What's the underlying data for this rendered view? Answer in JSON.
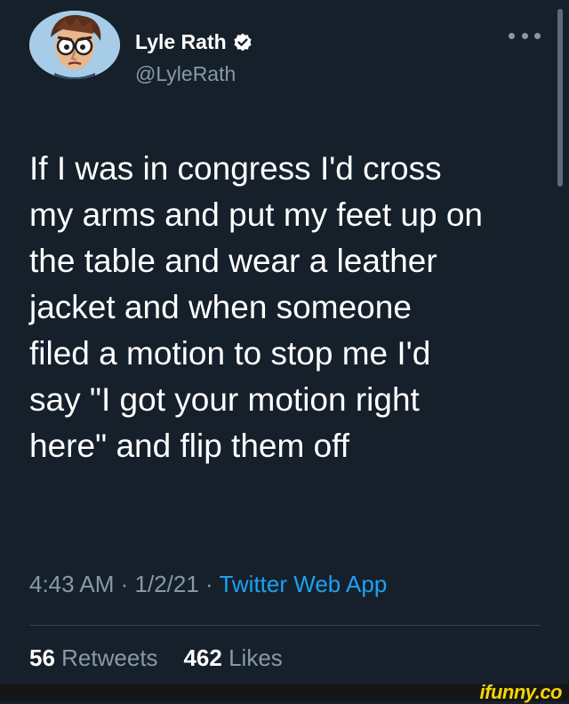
{
  "author": {
    "name": "Lyle Rath",
    "handle": "@LyleRath",
    "avatar_icon": "cartoon-face-avatar",
    "verified_icon": "verified-badge-icon"
  },
  "menu": {
    "icon": "more-options-icon"
  },
  "tweet": {
    "lines": [
      "If I was in congress I'd cross",
      "my arms and put my feet up on",
      "the table and wear a leather",
      "jacket and when someone",
      "filed a motion to stop me I'd",
      "say \"I got your motion right",
      "here\" and flip them off"
    ]
  },
  "meta": {
    "time": "4:43 AM",
    "separator": " · ",
    "date": "1/2/21",
    "source": "Twitter Web App"
  },
  "stats": {
    "retweets_count": "56",
    "retweets_label": "Retweets",
    "likes_count": "462",
    "likes_label": "Likes"
  },
  "watermark": {
    "text": "ifunny.co"
  },
  "colors": {
    "background": "#15202b",
    "text": "#ffffff",
    "secondary": "#8899a6",
    "link": "#1da1f2",
    "verified": "#ffffff",
    "watermark": "#f5d600"
  }
}
